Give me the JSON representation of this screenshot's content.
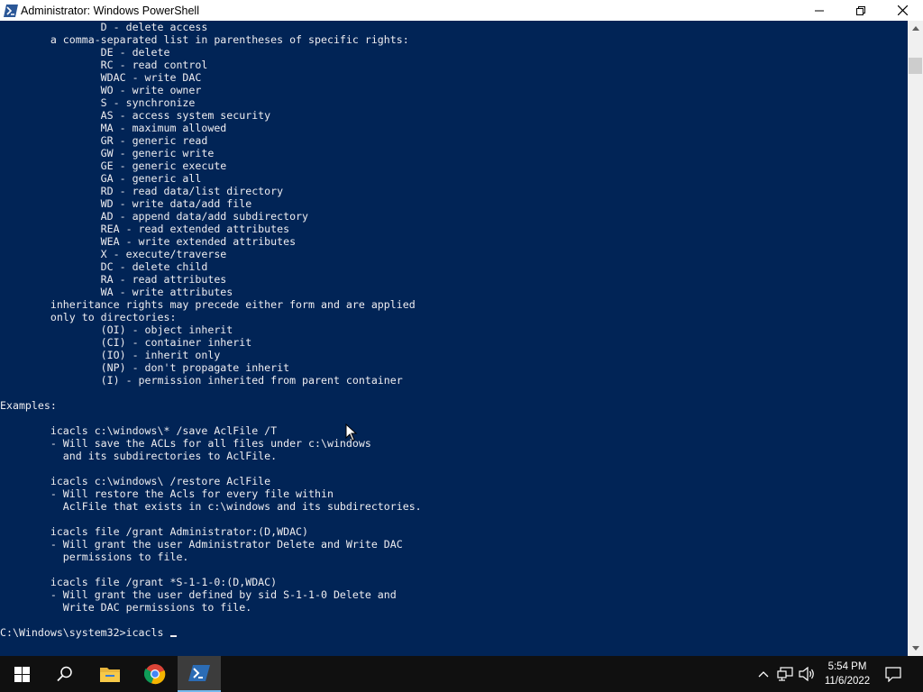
{
  "window": {
    "title": "Administrator: Windows PowerShell",
    "controls": [
      "minimize",
      "restore",
      "close"
    ]
  },
  "console": {
    "lines": [
      "                D - delete access",
      "        a comma-separated list in parentheses of specific rights:",
      "                DE - delete",
      "                RC - read control",
      "                WDAC - write DAC",
      "                WO - write owner",
      "                S - synchronize",
      "                AS - access system security",
      "                MA - maximum allowed",
      "                GR - generic read",
      "                GW - generic write",
      "                GE - generic execute",
      "                GA - generic all",
      "                RD - read data/list directory",
      "                WD - write data/add file",
      "                AD - append data/add subdirectory",
      "                REA - read extended attributes",
      "                WEA - write extended attributes",
      "                X - execute/traverse",
      "                DC - delete child",
      "                RA - read attributes",
      "                WA - write attributes",
      "        inheritance rights may precede either form and are applied",
      "        only to directories:",
      "                (OI) - object inherit",
      "                (CI) - container inherit",
      "                (IO) - inherit only",
      "                (NP) - don't propagate inherit",
      "                (I) - permission inherited from parent container",
      "",
      "Examples:",
      "",
      "        icacls c:\\windows\\* /save AclFile /T",
      "        - Will save the ACLs for all files under c:\\windows",
      "          and its subdirectories to AclFile.",
      "",
      "        icacls c:\\windows\\ /restore AclFile",
      "        - Will restore the Acls for every file within",
      "          AclFile that exists in c:\\windows and its subdirectories.",
      "",
      "        icacls file /grant Administrator:(D,WDAC)",
      "        - Will grant the user Administrator Delete and Write DAC",
      "          permissions to file.",
      "",
      "        icacls file /grant *S-1-1-0:(D,WDAC)",
      "        - Will grant the user defined by sid S-1-1-0 Delete and",
      "          Write DAC permissions to file.",
      "",
      "C:\\Windows\\system32>icacls "
    ]
  },
  "taskbar": {
    "items": [
      "start-button",
      "search-icon",
      "file-explorer-icon",
      "chrome-icon",
      "powershell-icon"
    ],
    "active_item": "powershell-icon",
    "tray": [
      "chevron-up-icon",
      "network-icon",
      "volume-icon"
    ],
    "time": "5:54 PM",
    "date": "11/6/2022"
  },
  "colors": {
    "console_background": "#012456",
    "console_text": "#eeedf0",
    "taskbar": "#101010",
    "accent": "#76b9ed"
  }
}
